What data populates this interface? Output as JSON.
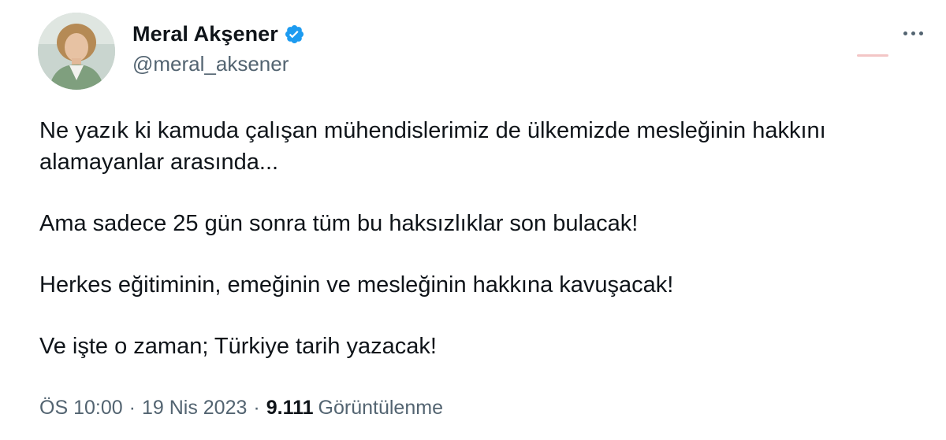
{
  "author": {
    "display_name": "Meral Akşener",
    "handle": "@meral_aksener",
    "verified": true,
    "verified_color": "#1d9bf0"
  },
  "tweet": {
    "paragraphs": [
      "Ne yazık ki kamuda çalışan mühendislerimiz de ülkemizde mesleğinin hakkını alamayanlar arasında...",
      "Ama sadece 25 gün sonra tüm bu haksızlıklar son bulacak!",
      "Herkes eğitiminin, emeğinin ve mesleğinin hakkına kavuşacak!",
      "Ve işte o zaman; Türkiye tarih yazacak!"
    ]
  },
  "meta": {
    "time": "ÖS 10:00",
    "separator": "·",
    "date": "19 Nis 2023",
    "views_count": "9.111",
    "views_label": "Görüntülenme"
  },
  "icons": {
    "more": "more-horizontal-icon",
    "verified": "verified-badge-icon"
  },
  "colors": {
    "text_primary": "#0f1419",
    "text_secondary": "#536471",
    "accent": "#1d9bf0"
  }
}
